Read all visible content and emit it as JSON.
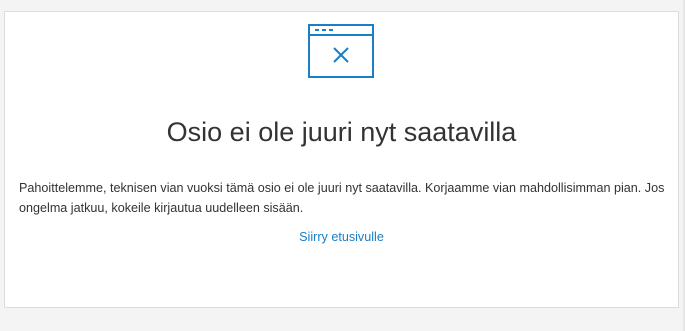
{
  "error_panel": {
    "icon": "browser-window-error-icon",
    "title": "Osio ei ole juuri nyt saatavilla",
    "message": "Pahoittelemme, teknisen vian vuoksi tämä osio ei ole juuri nyt saatavilla. Korjaamme vian mahdollisimman pian. Jos ongelma jatkuu, kokeile kirjautua uudelleen sisään.",
    "link_label": "Siirry etusivulle"
  },
  "colors": {
    "accent": "#1a7fc6",
    "text": "#333333",
    "background": "#f4f4f4",
    "panel": "#ffffff",
    "border": "#dcdcdc"
  }
}
